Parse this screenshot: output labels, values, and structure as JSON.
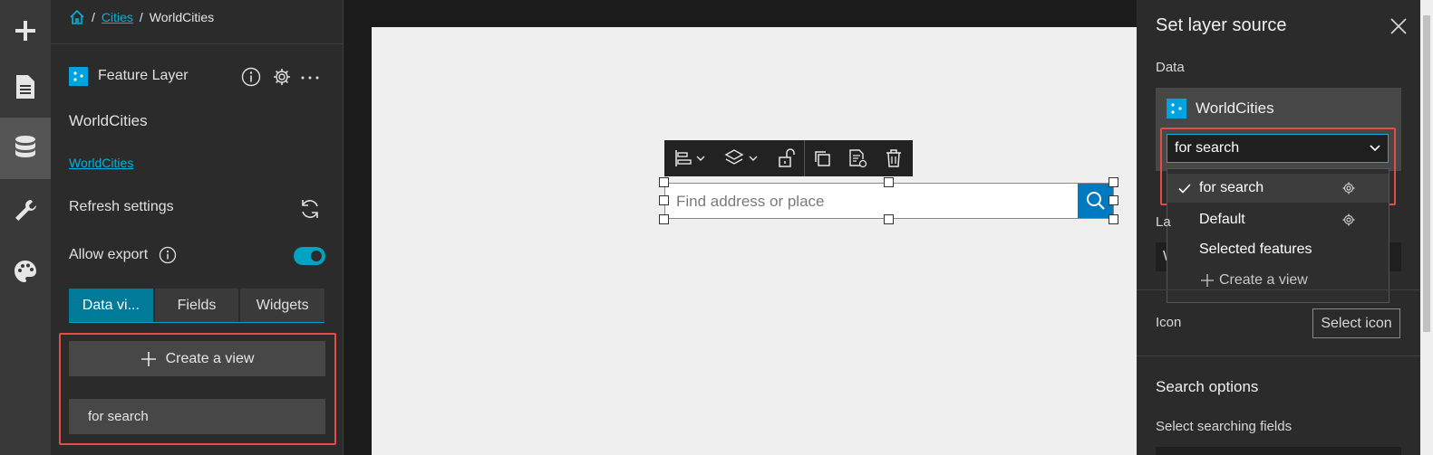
{
  "breadcrumb": {
    "separator": "/",
    "parent": "Cities",
    "current": "WorldCities"
  },
  "rail": {
    "items": [
      "add-icon",
      "page-icon",
      "data-icon",
      "tools-icon",
      "theme-icon"
    ],
    "active": 2
  },
  "left_panel": {
    "layer_type": "Feature Layer",
    "layer_name": "WorldCities",
    "layer_link": "WorldCities",
    "refresh_label": "Refresh settings",
    "allow_export_label": "Allow export",
    "allow_export_on": true,
    "tabs": [
      "Data vi...",
      "Fields",
      "Widgets"
    ],
    "active_tab": 0,
    "create_view_label": "Create a view",
    "view_item": "for search"
  },
  "canvas": {
    "search_placeholder": "Find address or place"
  },
  "right_panel": {
    "title": "Set layer source",
    "data_label": "Data",
    "data_source_name": "WorldCities",
    "selected_view": "for search",
    "dropdown": [
      {
        "label": "for search",
        "checked": true,
        "settings": true
      },
      {
        "label": "Default",
        "checked": false,
        "settings": true
      },
      {
        "label": "Selected features",
        "checked": false,
        "settings": false
      },
      {
        "label": "Create a view",
        "checked": false,
        "settings": false,
        "add": true
      }
    ],
    "label_partial": "La",
    "input_partial": "W",
    "icon_label": "Icon",
    "select_icon_label": "Select icon",
    "search_options_title": "Search options",
    "select_fields_label": "Select searching fields"
  },
  "colors": {
    "accent": "#00a3c2",
    "highlight": "#e84a4a",
    "search_button": "#0079c1",
    "layer_icon": "#00a3e0"
  }
}
